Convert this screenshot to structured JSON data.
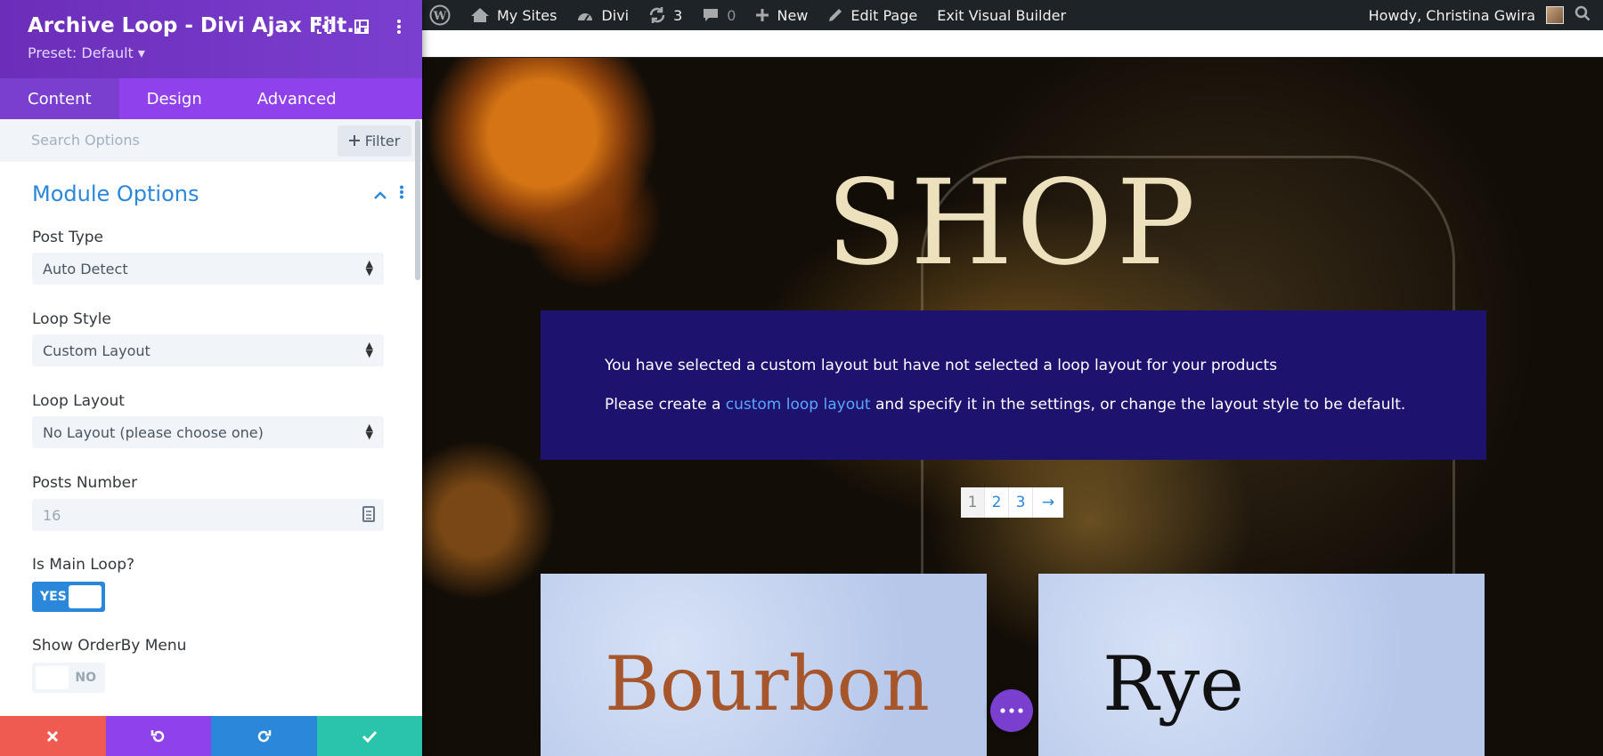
{
  "panel": {
    "title": "Archive Loop - Divi Ajax Filt...",
    "preset": "Preset: Default ▾",
    "tabs": [
      "Content",
      "Design",
      "Advanced"
    ],
    "search_placeholder": "Search Options",
    "filter_label": "Filter",
    "section_title": "Module Options",
    "post_type": {
      "label": "Post Type",
      "value": "Auto Detect"
    },
    "loop_style": {
      "label": "Loop Style",
      "value": "Custom Layout"
    },
    "loop_layout": {
      "label": "Loop Layout",
      "value": "No Layout (please choose one)"
    },
    "posts_number": {
      "label": "Posts Number",
      "value": "16"
    },
    "is_main_loop": {
      "label": "Is Main Loop?",
      "state": "YES"
    },
    "show_orderby": {
      "label": "Show OrderBy Menu",
      "state": "NO"
    },
    "colors": {
      "header": "#7b3fd0",
      "tabs": "#8f42ec",
      "accent": "#2b87da",
      "cancel": "#ef5a51",
      "save": "#29c4a9"
    }
  },
  "adminbar": {
    "my_sites": "My Sites",
    "divi": "Divi",
    "updates": "3",
    "comments": "0",
    "new": "New",
    "edit_page": "Edit Page",
    "exit_builder": "Exit Visual Builder",
    "greeting": "Howdy, Christina Gwira"
  },
  "preview": {
    "shop_title": "SHOP",
    "notice_line1": "You have selected a custom layout but have not selected a loop layout for your products",
    "notice_line2_pre": "Please create a ",
    "notice_link": "custom loop layout",
    "notice_line2_post": " and specify it in the settings, or change the layout style to be default.",
    "pages": [
      "1",
      "2",
      "3"
    ],
    "next_arrow": "→",
    "cards": [
      "Bourbon",
      "Rye"
    ]
  }
}
